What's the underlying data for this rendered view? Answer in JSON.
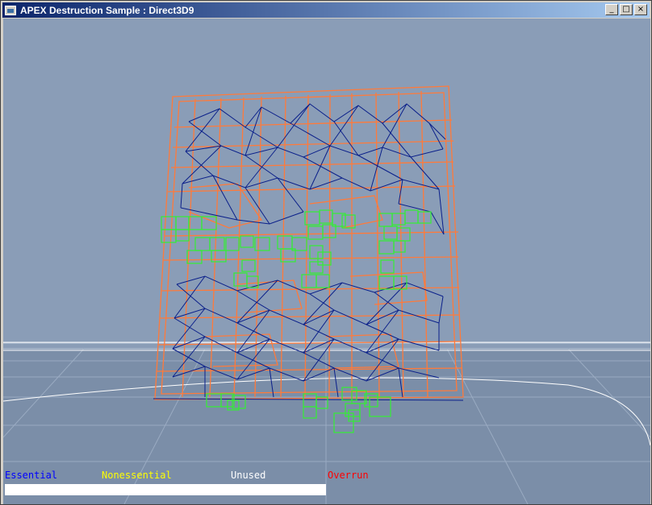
{
  "window": {
    "title": "APEX Destruction Sample : Direct3D9",
    "minimize_glyph": "_",
    "maximize_glyph": "□",
    "close_glyph": "×"
  },
  "legend": {
    "essential": "Essential",
    "nonessential": "Nonessential",
    "unused": "Unused",
    "overrun": "Overrun"
  },
  "colors": {
    "sky": "#8a9db7",
    "essential": "#0000ff",
    "nonessential": "#ffff00",
    "unused": "#ffffff",
    "overrun": "#ff0000",
    "chunk_wire": "#ff7a3a",
    "mesh_wire": "#0a1f8a",
    "fragment_wire": "#33ee33"
  },
  "memory_bar": {
    "essential_fraction": 0.5
  }
}
